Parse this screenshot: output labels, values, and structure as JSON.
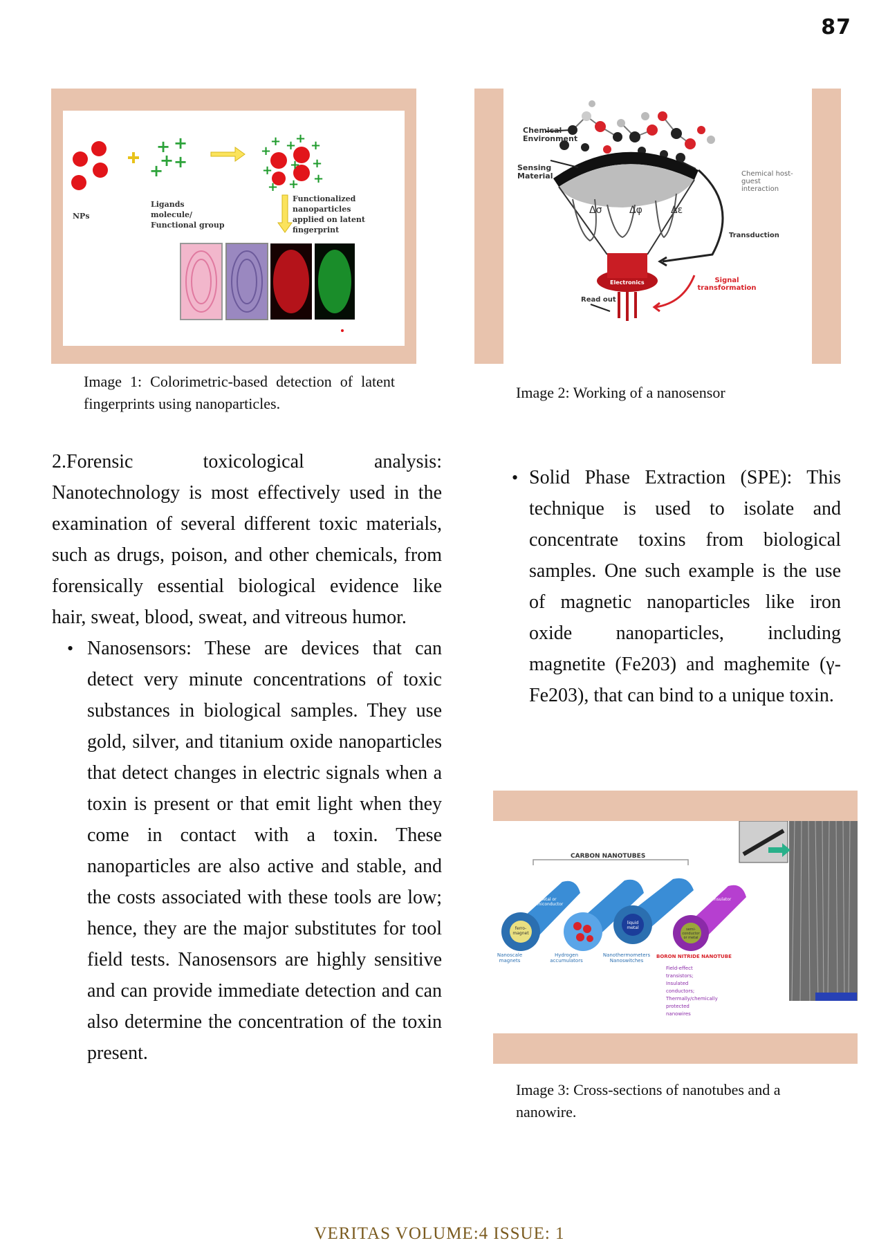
{
  "page_number": "87",
  "image1": {
    "np_label": "NPs",
    "ligand_label": "Ligands molecule/ Functional group",
    "functionalized_label": "Functionalized nanoparticles applied on latent fingerprint",
    "caption": "Image 1: Colorimetric-based detection of latent fingerprints using nanoparticles."
  },
  "image2": {
    "labels": {
      "chemical_environment": "Chemical Environment",
      "sensing_material": "Sensing Material",
      "chemical_host_guest": "Chemical host-guest interaction",
      "transduction": "Transduction",
      "signal_transformation": "Signal transformation",
      "read_out": "Read out",
      "electronics": "Electronics",
      "d_sigma": "Δσ",
      "d_phi": "Δφ",
      "d_epsilon": "Δε"
    },
    "caption": "Image 2: Working of a nanosensor"
  },
  "image3": {
    "title": "CARBON NANOTUBES",
    "tube_labels": [
      "metal or semiconductor",
      "ferro-magnet",
      "liquid metal",
      "insulator",
      "semi-conductor or metal"
    ],
    "bottom_labels": [
      "Nanoscale magnets",
      "Hydrogen accumulators",
      "Nanothermometers Nanoswitches",
      "BORON NITRIDE NANOTUBE"
    ],
    "bn_uses": "Field-effect transistors; Insulated conductors; Thermally/chemically protected nanowires",
    "caption": "Image 3: Cross-sections of nanotubes and a nanowire."
  },
  "left_column": {
    "heading_line": [
      "2.Forensic",
      "toxicological",
      "analysis:"
    ],
    "paragraph": "Nanotechnology is most effectively used in the examination of several different toxic materials, such as drugs, poison, and other chemicals, from forensically essential biological evidence like hair, sweat, blood, sweat, and vitreous humor.",
    "bullet": "Nanosensors: These are devices that can detect very minute concentrations of toxic substances in biological samples. They use gold, silver, and titanium oxide nanoparticles that detect changes in electric signals when a toxin is present or that emit light when they come in contact with a toxin. These nanoparticles are also active and stable, and the costs associated with these tools are low; hence, they are the major substitutes for tool field tests. Nanosensors are highly sensitive and can provide immediate detection and can also determine the concentration of the toxin present."
  },
  "right_column": {
    "bullet": "Solid Phase Extraction (SPE): This technique is used to isolate and concentrate toxins from biological samples. One such example is the use of magnetic nanoparticles like iron oxide nanoparticles, including magnetite (Fe203) and maghemite (γ-Fe203), that can bind to a unique toxin."
  },
  "footer": "VERITAS VOLUME:4 ISSUE: 1",
  "colors": {
    "frame": "#e8c3ad",
    "footer": "#7a5a1e"
  }
}
